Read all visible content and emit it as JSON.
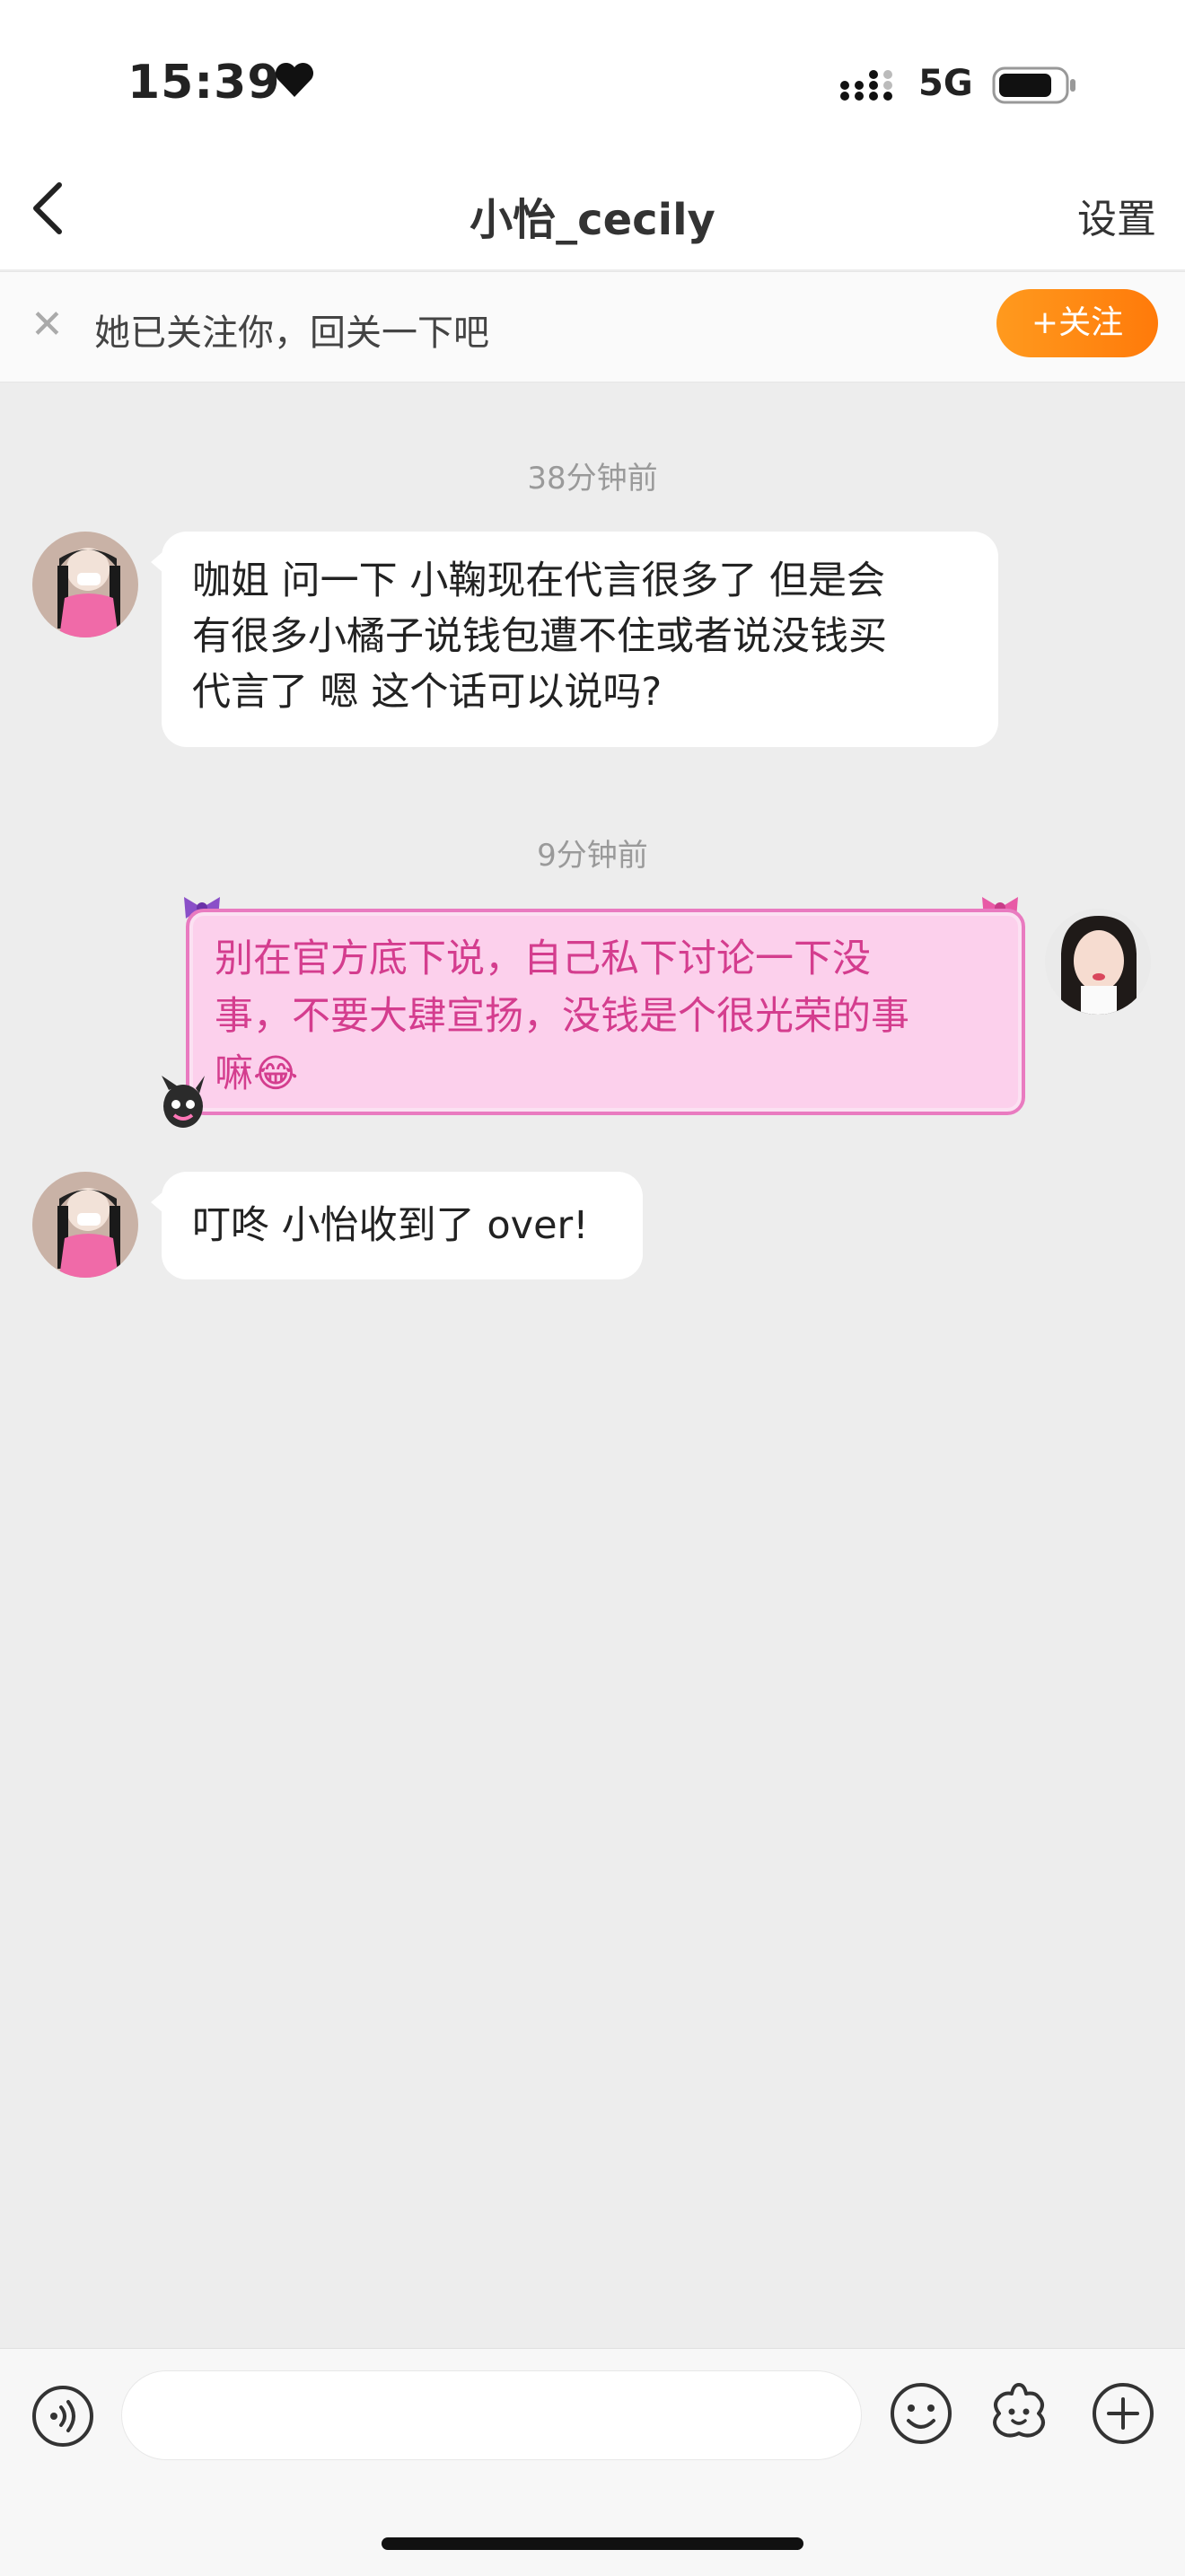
{
  "status_bar": {
    "time": "15:39",
    "network": "5G"
  },
  "header": {
    "back": "",
    "title": "小怡_cecily",
    "settings_label": "设置"
  },
  "banner": {
    "text": "她已关注你，回关一下吧",
    "follow_label": "+关注"
  },
  "messages": [
    {
      "timestamp": "38分钟前"
    },
    {
      "sender": "other",
      "lines": [
        "咖姐 问一下 小鞠现在代言很多了 但是会",
        "有很多小橘子说钱包遭不住或者说没钱买",
        "代言了 嗯 这个话可以说吗?"
      ]
    },
    {
      "timestamp": "9分钟前"
    },
    {
      "sender": "me",
      "lines": [
        "别在官方底下说，自己私下讨论一下没",
        "事，不要大肆宣扬，没钱是个很光荣的事",
        "嘛"
      ],
      "emoji": "😂"
    },
    {
      "sender": "other",
      "lines": [
        "叮咚 小怡收到了 over!"
      ]
    }
  ],
  "input": {
    "placeholder": ""
  },
  "colors": {
    "accent": "#ff8a14",
    "my_bubble_text": "#d43d8e",
    "my_bubble_bg": "#fcd0ec"
  }
}
